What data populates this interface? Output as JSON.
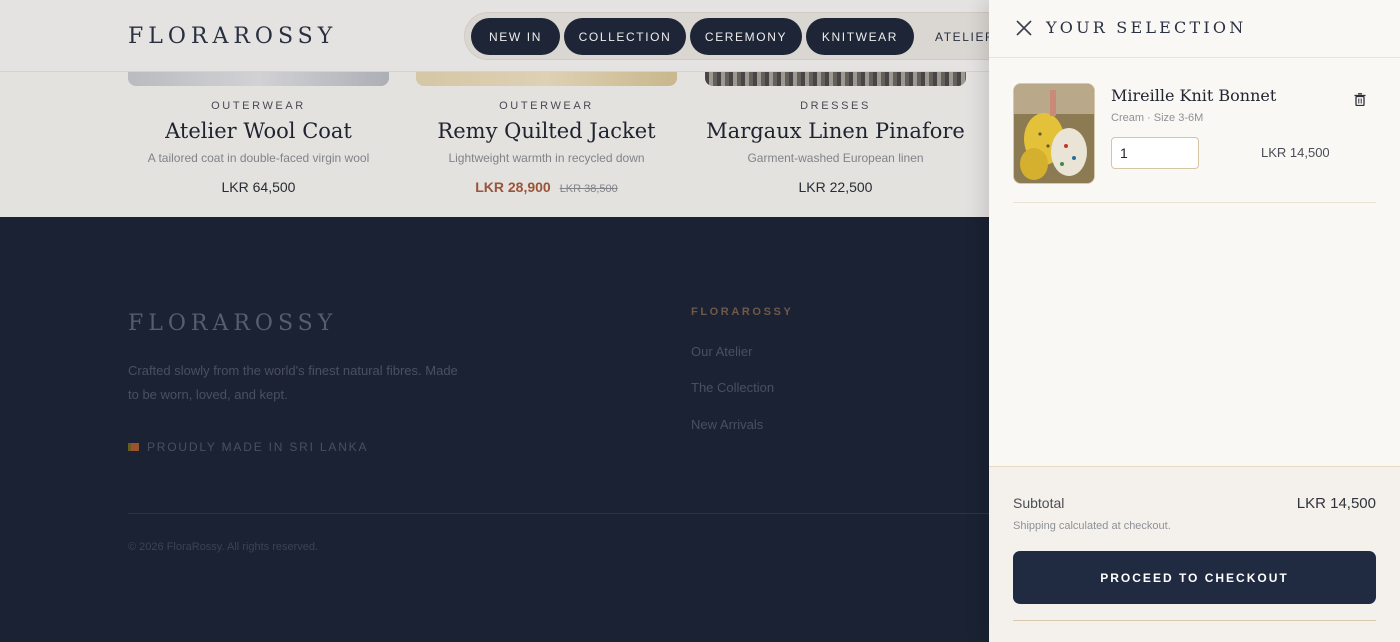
{
  "header": {
    "logo": "FLORAROSSY",
    "nav": [
      "NEW IN",
      "COLLECTION",
      "CEREMONY",
      "KNITWEAR"
    ],
    "nav_extra": "ATELIER"
  },
  "products": [
    {
      "category": "OUTERWEAR",
      "name": "Atelier Wool Coat",
      "description": "A tailored coat in double-faced virgin wool",
      "price": "LKR 64,500"
    },
    {
      "category": "OUTERWEAR",
      "name": "Remy Quilted Jacket",
      "description": "Lightweight warmth in recycled down",
      "price": "LKR 28,900",
      "old_price": "LKR 38,500"
    },
    {
      "category": "DRESSES",
      "name": "Margaux Linen Pinafore",
      "description": "Garment-washed European linen",
      "price": "LKR 22,500"
    }
  ],
  "footer": {
    "logo": "FLORAROSSY",
    "tagline": "Crafted slowly from the world's finest natural fibres. Made to be worn, loved, and kept.",
    "made_in": "PROUDLY MADE IN SRI LANKA",
    "column_heading": "FLORAROSSY",
    "links": [
      "Our Atelier",
      "The Collection",
      "New Arrivals"
    ],
    "copyright": "© 2026 FloraRossy. All rights reserved."
  },
  "drawer": {
    "title": "YOUR SELECTION",
    "item": {
      "name": "Mireille Knit Bonnet",
      "variant": "Cream · Size 3-6M",
      "quantity": "1",
      "price": "LKR 14,500"
    },
    "subtotal_label": "Subtotal",
    "subtotal_value": "LKR 14,500",
    "shipping_note": "Shipping calculated at checkout.",
    "checkout_label": "PROCEED TO CHECKOUT"
  },
  "colors": {
    "navy": "#1e2638",
    "sale": "#a45a3c",
    "accent_gold": "#d4c5a3",
    "footer_bg": "#1b2335"
  },
  "icons": [
    "close-icon",
    "trash-icon",
    "flag-icon"
  ]
}
